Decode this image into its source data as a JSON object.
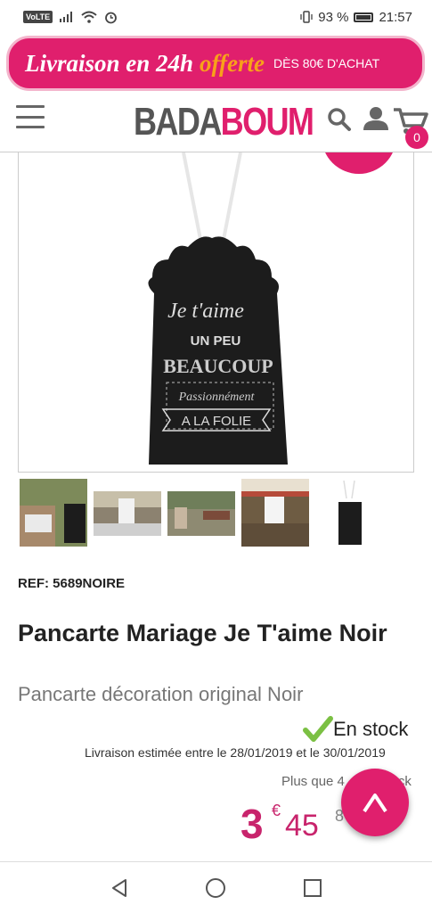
{
  "status_bar": {
    "network": "VoLTE",
    "battery": "93 %",
    "time": "21:57"
  },
  "promo": {
    "main": "Livraison en 24h",
    "accent": "offerte",
    "small": "DÈS 80€ D'ACHAT"
  },
  "header": {
    "logo_part1": "BADA",
    "logo_part2": "BOUM",
    "cart_count": "0"
  },
  "product_image": {
    "line1": "Je t'aime",
    "line2": "UN PEU",
    "line3": "BEAUCOUP",
    "line4": "Passionnément",
    "line5": "A LA FOLIE"
  },
  "product": {
    "ref": "REF: 5689NOIRE",
    "title": "Pancarte Mariage Je T'aime Noir",
    "subtitle": "Pancarte décoration original Noir",
    "stock": "En stock",
    "delivery": "Livraison estimée entre le 28/01/2019 et le 30/01/2019",
    "stock_left": "Plus que 4",
    "stock_left_tail": "ck",
    "price_int": "3",
    "price_cur": "€",
    "price_dec": "45",
    "price_secondary": "8"
  },
  "colors": {
    "brand_pink": "#e01f6d",
    "accent_orange": "#f8a11a"
  }
}
